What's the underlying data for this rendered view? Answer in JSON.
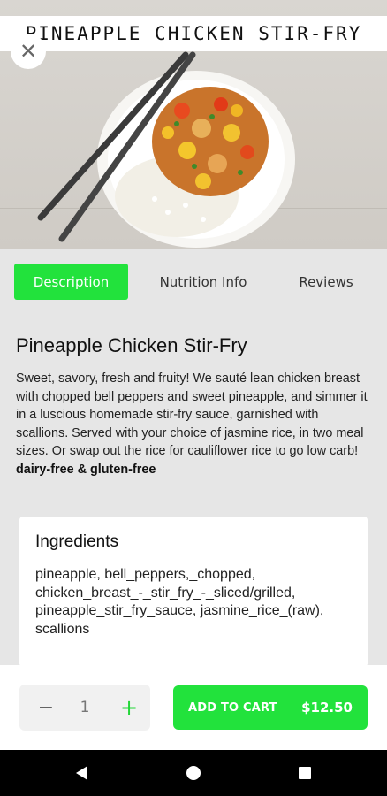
{
  "header": {
    "title": "PINEAPPLE CHICKEN STIR-FRY",
    "close_icon": "close-icon"
  },
  "hero": {
    "image": "dish-photo"
  },
  "tabs": [
    {
      "label": "Description",
      "active": true
    },
    {
      "label": "Nutrition Info",
      "active": false
    },
    {
      "label": "Reviews",
      "active": false
    }
  ],
  "product": {
    "name": "Pineapple Chicken Stir-Fry",
    "description": "Sweet, savory, fresh and fruity! We sauté lean chicken breast with chopped bell peppers and sweet pineapple, and simmer it in a luscious homemade stir-fry sauce, garnished with scallions. Served with your choice of jasmine rice, in two meal sizes. Or swap out the rice for cauliflower rice to go low carb!",
    "description_bold": "dairy-free & gluten-free"
  },
  "ingredients": {
    "title": "Ingredients",
    "text": "pineapple, bell_peppers,_chopped, chicken_breast_-_stir_fry_-_sliced/grilled, pineapple_stir_fry_sauce, jasmine_rice_(raw), scallions"
  },
  "cart": {
    "minus": "−",
    "quantity": "1",
    "plus": "+",
    "add_label": "ADD TO CART",
    "price": "$12.50"
  },
  "colors": {
    "accent": "#22e23c",
    "background": "#e6e6e6"
  },
  "nav": {
    "back_icon": "back-icon",
    "home_icon": "home-icon",
    "recents_icon": "recents-icon"
  }
}
